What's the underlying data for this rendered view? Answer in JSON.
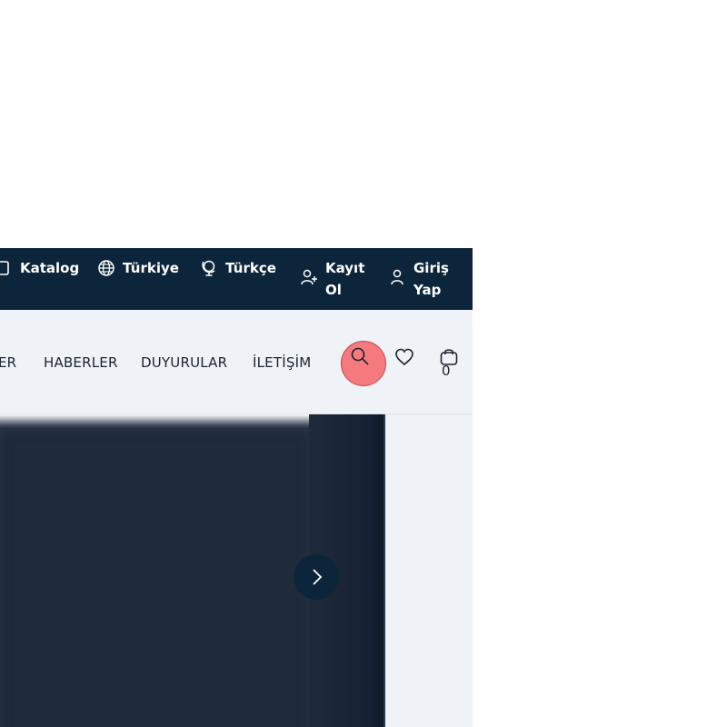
{
  "topbar": {
    "items": [
      {
        "icon": "catalog-icon",
        "label": "Katalog"
      },
      {
        "icon": "globe-icon",
        "label": "Türkiye"
      },
      {
        "icon": "language-globe-icon",
        "label": "Türkçe"
      },
      {
        "icon": "user-plus-icon",
        "label": "Kayıt\nOl"
      },
      {
        "icon": "user-icon",
        "label": "Giriş\nYap"
      }
    ]
  },
  "nav": {
    "links": [
      "ER",
      "HABERLER",
      "DUYURULAR",
      "İLETİŞİM"
    ],
    "cart_count": "0"
  },
  "colors": {
    "topbar_bg": "#0c253a",
    "nav_bg": "#eff2f7",
    "hero_bg": "#1f2a3a",
    "highlight": "#f47a7d"
  }
}
